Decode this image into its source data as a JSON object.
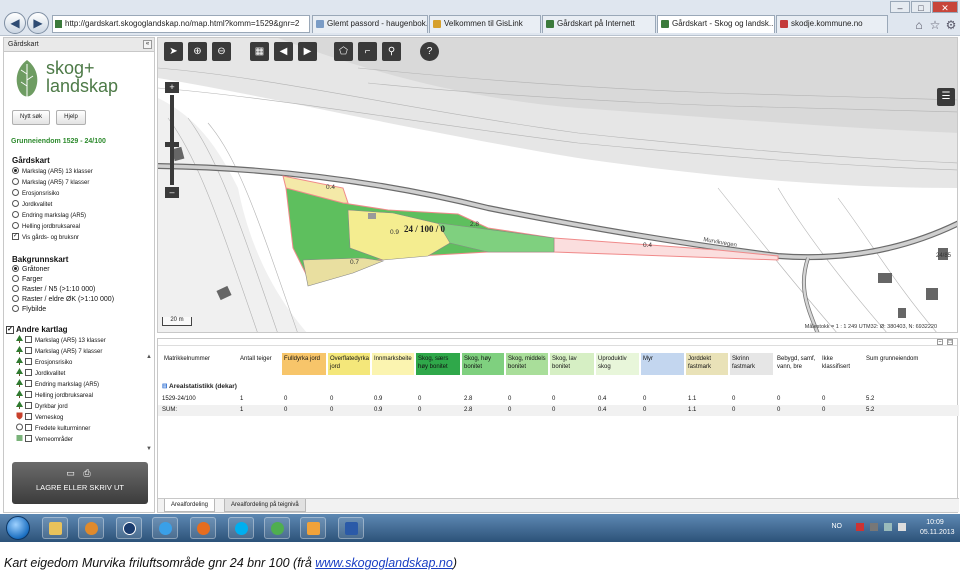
{
  "browser": {
    "address": "http://gardskart.skogoglandskap.no/map.html?komm=1529&gnr=2",
    "tabs": [
      {
        "label": "Glemt passord - haugenbok.n..."
      },
      {
        "label": "Velkommen til GisLink"
      },
      {
        "label": "Gårdskart på Internett"
      },
      {
        "label": "Gårdskart - Skog og landsk..."
      },
      {
        "label": "skodje.kommune.no"
      }
    ],
    "nav_icons": [
      "back-arrow-icon",
      "forward-arrow-icon",
      "home-icon",
      "star-icon",
      "gear-icon"
    ]
  },
  "sidebar": {
    "header": "Gårdskart",
    "logo": {
      "line1": "skog+",
      "line2": "landskap"
    },
    "buttons": {
      "new_search": "Nytt søk",
      "help": "Hjelp"
    },
    "property_title": "Grunneiendom 1529 - 24/100",
    "gardskart": {
      "title": "Gårdskart",
      "options": [
        {
          "label": "Markslag (AR5) 13 klasser",
          "selected": true,
          "type": "radio"
        },
        {
          "label": "Markslag (AR5) 7 klasser",
          "selected": false,
          "type": "radio"
        },
        {
          "label": "Erosjonsrisiko",
          "selected": false,
          "type": "radio"
        },
        {
          "label": "Jordkvalitet",
          "selected": false,
          "type": "radio"
        },
        {
          "label": "Endring markslag (AR5)",
          "selected": false,
          "type": "radio"
        },
        {
          "label": "Helling jordbruksareal",
          "selected": false,
          "type": "radio"
        },
        {
          "label": "Vis gårds- og bruksnr",
          "selected": true,
          "type": "checkbox"
        }
      ]
    },
    "bakgrunnskart": {
      "title": "Bakgrunnskart",
      "options": [
        {
          "label": "Gråtoner",
          "selected": true
        },
        {
          "label": "Farger",
          "selected": false
        },
        {
          "label": "Raster / N5 (>1:10 000)",
          "selected": false
        },
        {
          "label": "Raster / eldre ØK (>1:10 000)",
          "selected": false
        },
        {
          "label": "Flybilde",
          "selected": false
        }
      ]
    },
    "andre_kartlag": {
      "title": "Andre kartlag",
      "checked": true,
      "layers": [
        {
          "label": "Markslag (AR5) 13 klasser"
        },
        {
          "label": "Markslag (AR5) 7 klasser"
        },
        {
          "label": "Erosjonsrisiko"
        },
        {
          "label": "Jordkvalitet"
        },
        {
          "label": "Endring markslag (AR5)"
        },
        {
          "label": "Helling jordbruksareal"
        },
        {
          "label": "Dyrkbar jord"
        },
        {
          "label": "Verneskog"
        },
        {
          "label": "Fredete kulturminner"
        },
        {
          "label": "Verneområder"
        }
      ]
    },
    "print_button": "LAGRE ELLER SKRIV UT"
  },
  "map": {
    "toolbar_icons": [
      "pointer-icon",
      "zoom-in-icon",
      "zoom-out-icon",
      "full-extent-icon",
      "previous-extent-icon",
      "next-extent-icon",
      "measure-area-icon",
      "measure-distance-icon",
      "info-pin-icon",
      "help-icon"
    ],
    "property_label": "24 / 100 / 0",
    "area_labels": [
      "0.4",
      "0.9",
      "2.8",
      "0.7",
      "0.4"
    ],
    "road_label": "Murvikvegen",
    "neighbor_label": "24/85",
    "scale_label": "20 m",
    "status": "Målestokk = 1 : 1 249  UTM32: Ø: 380403, N: 6932220",
    "colors": {
      "forest": "#5ebf5e",
      "forest_light": "#8fd48f",
      "cultivated": "#f4ed90",
      "pasture": "#e9dfa0",
      "boundary": "#f08a8a",
      "background": "#e4e4e4"
    }
  },
  "table": {
    "columns": [
      {
        "label": "Matrikkelnummer",
        "color": "#ffffff"
      },
      {
        "label": "Antall teiger",
        "color": "#ffffff"
      },
      {
        "label": "Fulldyrka jord",
        "color": "#f7c56a"
      },
      {
        "label": "Overflatedyrka jord",
        "color": "#f4e77a"
      },
      {
        "label": "Innmarksbeite",
        "color": "#fbf4b0"
      },
      {
        "label": "Skog, særs høy bonitet",
        "color": "#2fa84a"
      },
      {
        "label": "Skog, høy bonitet",
        "color": "#7fd07f"
      },
      {
        "label": "Skog, middels bonitet",
        "color": "#a9de9a"
      },
      {
        "label": "Skog, lav bonitet",
        "color": "#d6efc4"
      },
      {
        "label": "Uproduktiv skog",
        "color": "#e8f6da"
      },
      {
        "label": "Myr",
        "color": "#c3d6ef"
      },
      {
        "label": "Jorddekt fastmark",
        "color": "#e9e2b8"
      },
      {
        "label": "Skrinn fastmark",
        "color": "#e6e6e6"
      },
      {
        "label": "Bebygd, samf, vann, bre",
        "color": "#ffffff"
      },
      {
        "label": "Ikke klassifisert",
        "color": "#ffffff"
      },
      {
        "label": "Sum grunneiendom",
        "color": "#ffffff"
      }
    ],
    "stats_title": "Arealstatistikk (dekar)",
    "rows": [
      {
        "cells": [
          "1529-24/100",
          "1",
          "0",
          "0",
          "0.9",
          "0",
          "2.8",
          "0",
          "0",
          "0.4",
          "0",
          "1.1",
          "0",
          "0",
          "0",
          "5.2"
        ]
      },
      {
        "cells": [
          "SUM:",
          "1",
          "0",
          "0",
          "0.9",
          "0",
          "2.8",
          "0",
          "0",
          "0.4",
          "0",
          "1.1",
          "0",
          "0",
          "0",
          "5.2"
        ],
        "sum": true
      }
    ],
    "tabs": [
      "Arealfordeling",
      "Arealfordeling på teignivå"
    ]
  },
  "taskbar": {
    "icons": [
      "explorer-icon",
      "media-icon",
      "hp-icon",
      "ie-icon",
      "firefox-icon",
      "skype-icon",
      "network-icon",
      "outlook-icon",
      "word-icon"
    ],
    "lang": "NO",
    "time": "10:09",
    "date": "05.11.2013"
  },
  "caption": {
    "text": "Kart eigedom Murvika friluftsområde gnr 24 bnr 100 (frå ",
    "link": "www.skogoglandskap.no",
    "end": ")"
  }
}
